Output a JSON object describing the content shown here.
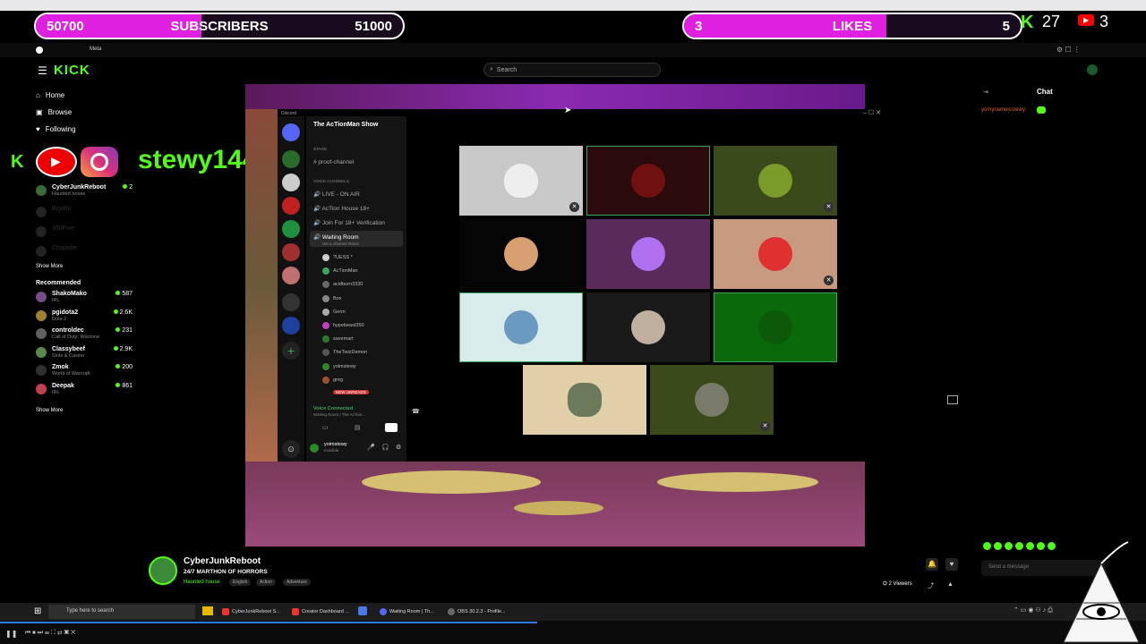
{
  "overlay": {
    "subscribers": {
      "start": "50700",
      "label": "SUBSCRIBERS",
      "goal": "51000",
      "progress": 0.45
    },
    "likes": {
      "current": "3",
      "label": "LIKES",
      "goal": "5",
      "progress": 0.6
    },
    "kick_count": "27",
    "youtube_count": "3",
    "social_handle": "stewy144"
  },
  "kick": {
    "logo": "KICK",
    "search_placeholder": "Search",
    "nav": [
      {
        "label": "Home",
        "icon": "home-icon"
      },
      {
        "label": "Browse",
        "icon": "browse-icon"
      },
      {
        "label": "Following",
        "icon": "heart-icon"
      }
    ],
    "following": [
      {
        "name": "CyberJunkReboot",
        "category": "Haunted house",
        "viewers": "2",
        "color": "#3a6b3a"
      },
      {
        "name": "Bigalto",
        "category": "",
        "viewers": "",
        "color": "#444"
      },
      {
        "name": "360Five",
        "category": "",
        "viewers": "",
        "color": "#444"
      },
      {
        "name": "Chapelle",
        "category": "",
        "viewers": "",
        "color": "#444"
      }
    ],
    "show_more": "Show More",
    "recommended_label": "Recommended",
    "recommended": [
      {
        "name": "ShakoMako",
        "category": "IRL",
        "viewers": "587",
        "color": "#7a4b8a"
      },
      {
        "name": "pgidota2",
        "category": "Dota 2",
        "viewers": "2.6K",
        "color": "#a08030"
      },
      {
        "name": "controldec",
        "category": "Call of Duty: Warzone",
        "viewers": "231",
        "color": "#606060"
      },
      {
        "name": "Classybeef",
        "category": "Slots & Casino",
        "viewers": "2.9K",
        "color": "#5a8a4a"
      },
      {
        "name": "Zmok",
        "category": "World of Warcraft",
        "viewers": "200",
        "color": "#303030"
      },
      {
        "name": "Deepak",
        "category": "IRL",
        "viewers": "861",
        "color": "#c04050"
      }
    ],
    "show_more_2": "Show More",
    "chat_title": "Chat",
    "chat_user": "yomynameisstewy:",
    "chat_placeholder": "Send a message",
    "viewers": "2 Viewers",
    "streamer": {
      "name": "CyberJunkReboot",
      "title": "24/7 MARTHON OF HORRORS",
      "category": "Haunted house",
      "tags": [
        "English",
        "Action",
        "Adventure"
      ]
    }
  },
  "discord": {
    "app_label": "Discord",
    "server_name": "The AcTionMan Show",
    "section_stage": "STAGE",
    "stage_channel": "proof-channel",
    "section_voice": "VOICE CHANNELS",
    "channels": [
      "LIVE - ON AIR",
      "AcTion House 18+",
      "Join For 18+ Verification"
    ],
    "active_channel": "Waiting Room",
    "status_hint": "Set a channel status",
    "voice_users": [
      "?UESS *",
      "AcTionMan",
      "acidburn3330",
      "Box",
      "Germ",
      "hypebeast350",
      "savemart",
      "TheTwizDemon",
      "yoimstewy",
      "greg"
    ],
    "new_unreads": "NEW UNREADS",
    "voice_connected": "Voice Connected",
    "voice_location": "Waiting Room / The AcTion...",
    "user_name": "yoimstewy",
    "user_status": "Invisible"
  },
  "taskbar": {
    "search_placeholder": "Type here to search",
    "apps": [
      "CyberJunkReboot S...",
      "Creator Dashboard ...",
      "Waiting Room | Th...",
      "OBS 30.2.3 - Profile..."
    ]
  },
  "colors": {
    "kick_green": "#53fc18",
    "magenta": "#e020e0",
    "youtube_red": "#ff0000"
  }
}
